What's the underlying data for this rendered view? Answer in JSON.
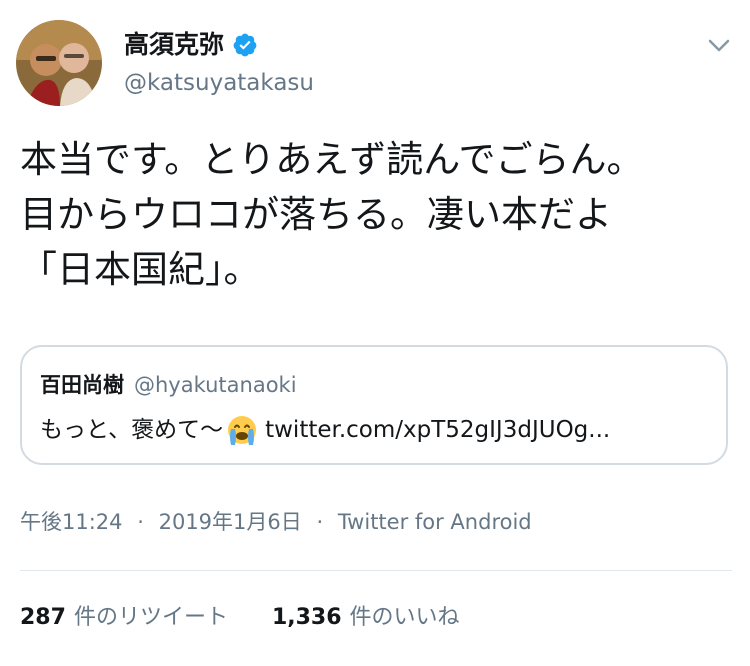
{
  "header": {
    "display_name": "高須克弥",
    "handle": "@katsuyatakasu",
    "verified_icon": "verified-badge-icon",
    "menu_icon": "chevron-down-icon"
  },
  "tweet": {
    "lines": [
      "本当です。とりあえず読んでごらん。",
      "目からウロコが落ちる。凄い本だよ",
      "「日本国紀」。"
    ]
  },
  "quote": {
    "name": "百田尚樹",
    "handle": "@hyakutanaoki",
    "text": "もっと、褒めて〜",
    "emoji": "crying-face-emoji",
    "link": "twitter.com/xpT52gIJ3dJUOg..."
  },
  "meta": {
    "time": "午後11:24",
    "separator": "·",
    "date": "2019年1月6日",
    "source": "Twitter for Android"
  },
  "stats": {
    "retweets_count": "287",
    "retweets_label": "件のリツイート",
    "likes_count": "1,336",
    "likes_label": "件のいいね"
  },
  "colors": {
    "text": "#14171a",
    "secondary": "#657786",
    "verified": "#1da1f2",
    "border": "#d3dbe2"
  }
}
